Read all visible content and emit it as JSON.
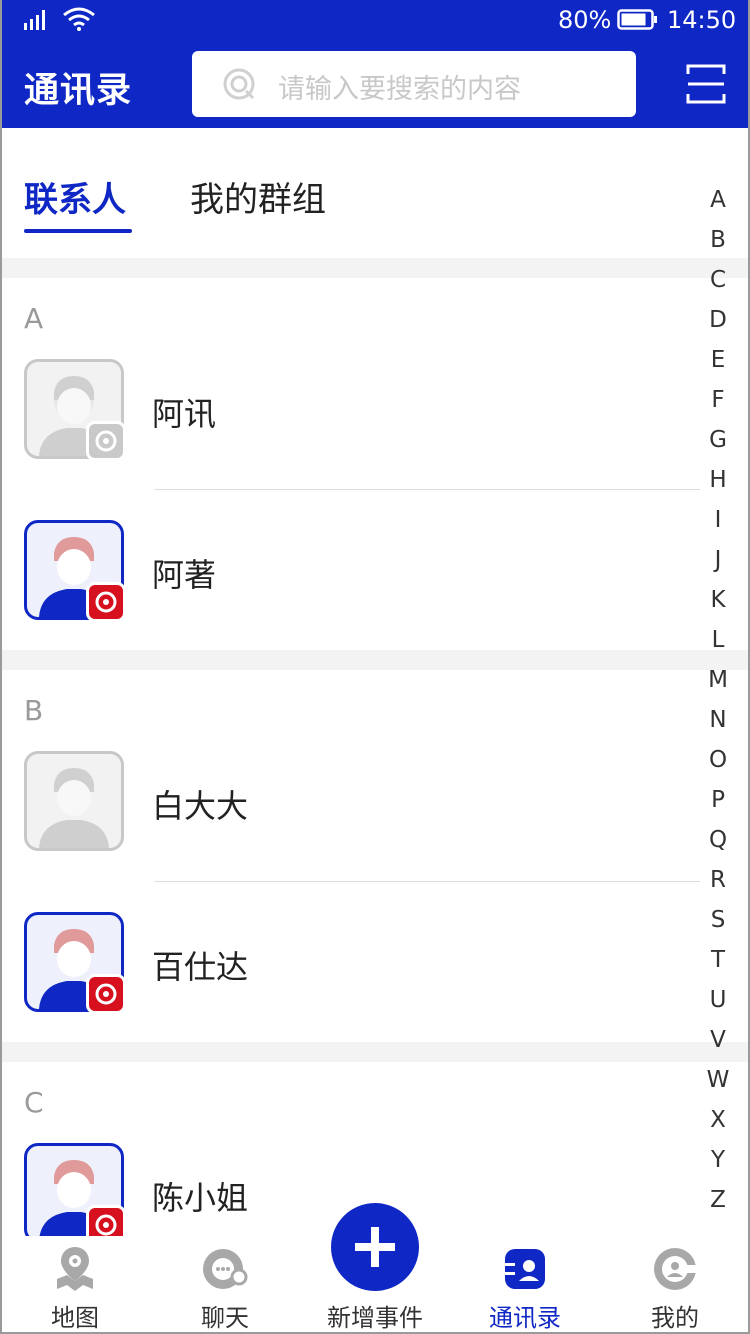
{
  "status": {
    "battery": "80%",
    "time": "14:50"
  },
  "header": {
    "title": "通讯录",
    "search_placeholder": "请输入要搜索的内容"
  },
  "tabs": [
    {
      "label": "联系人"
    },
    {
      "label": "我的群组"
    }
  ],
  "sections": [
    {
      "letter": "A",
      "contacts": [
        {
          "name": "阿讯",
          "online": false
        },
        {
          "name": "阿著",
          "online": true
        }
      ]
    },
    {
      "letter": "B",
      "contacts": [
        {
          "name": "白大大",
          "online": false
        },
        {
          "name": "百仕达",
          "online": true
        }
      ]
    },
    {
      "letter": "C",
      "contacts": [
        {
          "name": "陈小姐",
          "online": true
        }
      ]
    }
  ],
  "index_letters": [
    "A",
    "B",
    "C",
    "D",
    "E",
    "F",
    "G",
    "H",
    "I",
    "J",
    "K",
    "L",
    "M",
    "N",
    "O",
    "P",
    "Q",
    "R",
    "S",
    "T",
    "U",
    "V",
    "W",
    "X",
    "Y",
    "Z"
  ],
  "nav": [
    {
      "label": "地图",
      "icon": "map-pin-icon"
    },
    {
      "label": "聊天",
      "icon": "chat-icon"
    },
    {
      "label": "新增事件",
      "icon": "plus-icon"
    },
    {
      "label": "通讯录",
      "icon": "contacts-icon"
    },
    {
      "label": "我的",
      "icon": "profile-icon"
    }
  ],
  "colors": {
    "primary": "#0f27c4",
    "badge_red": "#d7101f",
    "inactive": "#c8c8c8"
  }
}
